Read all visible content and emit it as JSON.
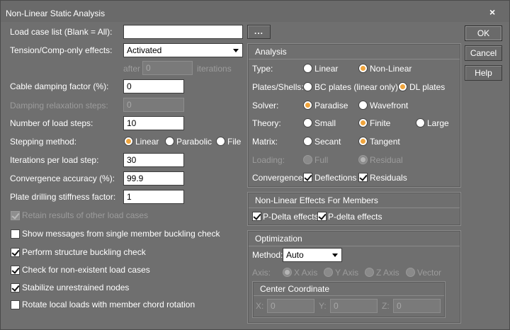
{
  "window": {
    "title": "Non-Linear Static Analysis",
    "close_glyph": "×"
  },
  "buttons": {
    "ok": "OK",
    "cancel": "Cancel",
    "help": "Help",
    "browse": "..."
  },
  "left": {
    "load_case_label": "Load case list (Blank = All):",
    "load_case_value": "",
    "tension_label": "Tension/Comp-only effects:",
    "tension_value": "Activated",
    "after_label": "after",
    "after_value": "0",
    "iterations_label": "iterations",
    "cable_label": "Cable damping factor (%):",
    "cable_value": "0",
    "damping_label": "Damping relaxation steps:",
    "damping_value": "0",
    "load_steps_label": "Number of load steps:",
    "load_steps_value": "10",
    "stepping_label": "Stepping method:",
    "stepping_options": [
      "Linear",
      "Parabolic",
      "File"
    ],
    "iter_step_label": "Iterations per load step:",
    "iter_step_value": "30",
    "convergence_label": "Convergence accuracy (%):",
    "convergence_value": "99.9",
    "drilling_label": "Plate drilling stiffness factor:",
    "drilling_value": "1",
    "checks": [
      {
        "label": "Retain results of other load cases",
        "checked": true,
        "disabled": true
      },
      {
        "label": "Show messages from single member buckling check",
        "checked": false,
        "disabled": false
      },
      {
        "label": "Perform structure buckling check",
        "checked": true,
        "disabled": false
      },
      {
        "label": "Check for non-existent load cases",
        "checked": true,
        "disabled": false
      },
      {
        "label": "Stabilize unrestrained nodes",
        "checked": true,
        "disabled": false
      },
      {
        "label": "Rotate local loads with member chord rotation",
        "checked": false,
        "disabled": false
      }
    ]
  },
  "analysis": {
    "title": "Analysis",
    "type_label": "Type:",
    "type_options": [
      "Linear",
      "Non-Linear"
    ],
    "plates_label": "Plates/Shells:",
    "plates_options": [
      "BC plates (linear only)",
      "DL plates"
    ],
    "solver_label": "Solver:",
    "solver_options": [
      "Paradise",
      "Wavefront"
    ],
    "theory_label": "Theory:",
    "theory_options": [
      "Small",
      "Finite",
      "Large"
    ],
    "matrix_label": "Matrix:",
    "matrix_options": [
      "Secant",
      "Tangent"
    ],
    "loading_label": "Loading:",
    "loading_options": [
      "Full",
      "Residual"
    ],
    "convergence_label": "Convergence:",
    "convergence_options": [
      "Deflections",
      "Residuals"
    ]
  },
  "members": {
    "title": "Non-Linear Effects For Members",
    "options": [
      "P-Delta effects",
      "P-delta effects"
    ]
  },
  "optimization": {
    "title": "Optimization",
    "method_label": "Method:",
    "method_value": "Auto",
    "axis_label": "Axis:",
    "axis_options": [
      "X Axis",
      "Y Axis",
      "Z Axis",
      "Vector"
    ],
    "center_title": "Center Coordinate",
    "x_label": "X:",
    "x_value": "0",
    "y_label": "Y:",
    "y_value": "0",
    "z_label": "Z:",
    "z_value": "0"
  }
}
